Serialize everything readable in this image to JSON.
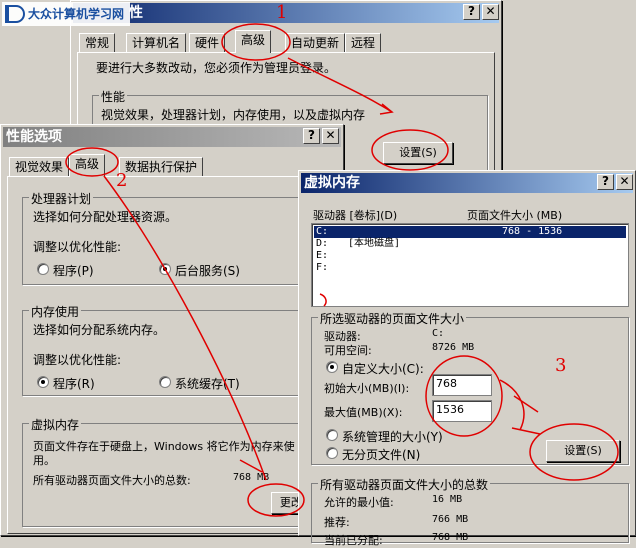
{
  "watermark": {
    "text": "大众计算机学习网"
  },
  "sysprops": {
    "title_suffix": "性",
    "tabs": [
      "常规",
      "计算机名",
      "硬件",
      "高级",
      "自动更新",
      "远程"
    ],
    "admin_note": "要进行大多数改动，您必须作为管理员登录。",
    "perf_group": "性能",
    "perf_desc": "视觉效果，处理器计划，内存使用，以及虚拟内存",
    "settings_btn": "设置(S)"
  },
  "perf": {
    "title": "性能选项",
    "tabs": [
      "视觉效果",
      "高级",
      "数据执行保护"
    ],
    "cpu": {
      "group": "处理器计划",
      "desc": "选择如何分配处理器资源。",
      "adjust": "调整以优化性能:",
      "opt1": "程序(P)",
      "opt2": "后台服务(S)"
    },
    "mem": {
      "group": "内存使用",
      "desc": "选择如何分配系统内存。",
      "adjust": "调整以优化性能:",
      "opt1": "程序(R)",
      "opt2": "系统缓存(T)"
    },
    "vm": {
      "group": "虚拟内存",
      "desc": "页面文件存在于硬盘上，Windows 将它作为内存来使",
      "desc2": "用。",
      "total_label": "所有驱动器页面文件大小的总数:",
      "total_value": "768 MB",
      "change_btn": "更改(C)"
    }
  },
  "vmdlg": {
    "title": "虚拟内存",
    "col_drive": "驱动器 [卷标](D)",
    "col_size": "页面文件大小 (MB)",
    "drives": [
      {
        "drive": "C:",
        "label": "",
        "size": "768 - 1536"
      },
      {
        "drive": "D:",
        "label": "[本地磁盘]",
        "size": ""
      },
      {
        "drive": "E:",
        "label": "",
        "size": ""
      },
      {
        "drive": "F:",
        "label": "",
        "size": ""
      }
    ],
    "selgroup": "所选驱动器的页面文件大小",
    "drive_label": "驱动器:",
    "drive_value": "C:",
    "avail_label": "可用空间:",
    "avail_value": "8726 MB",
    "custom": "自定义大小(C):",
    "init_label": "初始大小(MB)(I):",
    "init_value": "768",
    "max_label": "最大值(MB)(X):",
    "max_value": "1536",
    "system_managed": "系统管理的大小(Y)",
    "no_pagefile": "无分页文件(N)",
    "set_btn": "设置(S)",
    "totals_group": "所有驱动器页面文件大小的总数",
    "min_label": "允许的最小值:",
    "min_value": "16 MB",
    "rec_label": "推荐:",
    "rec_value": "766 MB",
    "cur_label": "当前已分配:",
    "cur_value": "768 MB"
  },
  "annotations": {
    "n1": "1",
    "n2": "2",
    "n3": "3"
  },
  "colors": {
    "annotation": "#e00000",
    "titlebar": "#0a246a",
    "selection": "#0a246a"
  }
}
